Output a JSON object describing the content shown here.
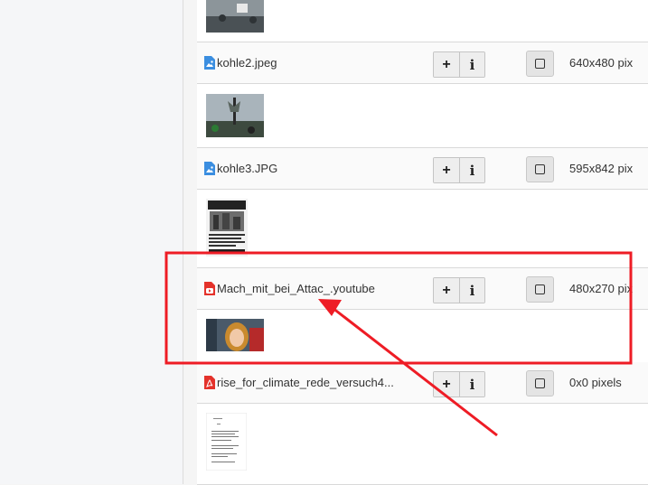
{
  "files": [
    {
      "name": "kohle2.jpeg",
      "icon": "image-file-icon",
      "dimensions": "640x480 pix"
    },
    {
      "name": "kohle3.JPG",
      "icon": "image-file-icon",
      "dimensions": "595x842 pix"
    },
    {
      "name": "Mach_mit_bei_Attac_.youtube",
      "icon": "youtube-file-icon",
      "dimensions": "480x270 pix"
    },
    {
      "name": "rise_for_climate_rede_versuch4...",
      "icon": "pdf-file-icon",
      "dimensions": "0x0 pixels"
    }
  ],
  "buttons": {
    "add_label": "+",
    "info_label": "i"
  },
  "colors": {
    "highlight": "#ee1c25",
    "image_icon": "#3b8ee0",
    "youtube_icon": "#e4322b",
    "pdf_icon": "#e4322b"
  }
}
